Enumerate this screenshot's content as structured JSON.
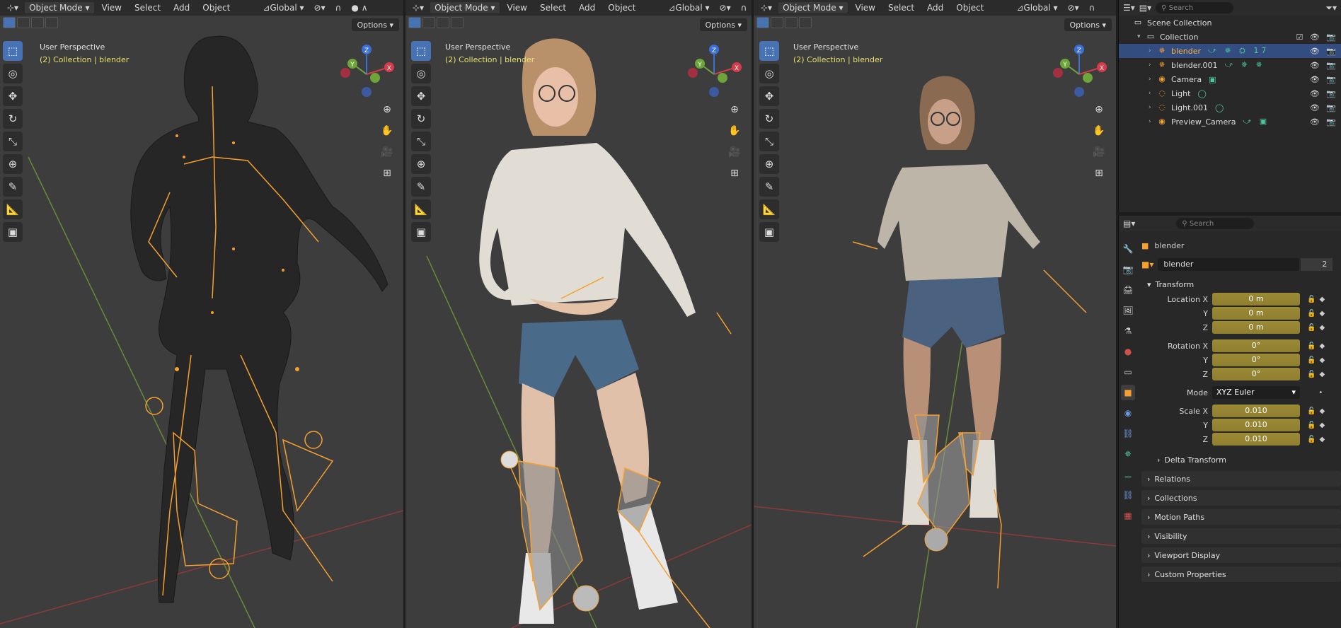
{
  "viewports": [
    {
      "header": {
        "mode": "Object Mode",
        "menus": [
          "View",
          "Select",
          "Add",
          "Object"
        ],
        "orientation": "Global"
      },
      "options": "Options",
      "perspective": "User Perspective",
      "collection_info": "(2) Collection | blender"
    },
    {
      "header": {
        "mode": "Object Mode",
        "menus": [
          "View",
          "Select",
          "Add",
          "Object"
        ],
        "orientation": "Global"
      },
      "options": "Options",
      "perspective": "User Perspective",
      "collection_info": "(2) Collection | blender"
    },
    {
      "header": {
        "mode": "Object Mode",
        "menus": [
          "View",
          "Select",
          "Add",
          "Object"
        ],
        "orientation": "Global"
      },
      "options": "Options",
      "perspective": "User Perspective",
      "collection_info": "(2) Collection | blender"
    }
  ],
  "gizmo": {
    "x": "X",
    "y": "Y",
    "z": "Z"
  },
  "outliner": {
    "search_placeholder": "Search",
    "scene_collection": "Scene Collection",
    "collection": "Collection",
    "items": [
      {
        "name": "blender",
        "extra": "17"
      },
      {
        "name": "blender.001",
        "extra": ""
      },
      {
        "name": "Camera",
        "extra": ""
      },
      {
        "name": "Light",
        "extra": ""
      },
      {
        "name": "Light.001",
        "extra": ""
      },
      {
        "name": "Preview_Camera",
        "extra": ""
      }
    ]
  },
  "properties": {
    "search_placeholder": "Search",
    "object_name": "blender",
    "data_name": "blender",
    "data_users": "2",
    "transform_label": "Transform",
    "location": {
      "label": "Location X",
      "x": "0 m",
      "y": "0 m",
      "z": "0 m"
    },
    "rotation": {
      "label": "Rotation X",
      "x": "0°",
      "y": "0°",
      "z": "0°"
    },
    "mode": {
      "label": "Mode",
      "value": "XYZ Euler"
    },
    "scale": {
      "label": "Scale X",
      "x": "0.010",
      "y": "0.010",
      "z": "0.010"
    },
    "axis_y": "Y",
    "axis_z": "Z",
    "delta_transform": "Delta Transform",
    "sections": [
      "Relations",
      "Collections",
      "Motion Paths",
      "Visibility",
      "Viewport Display",
      "Custom Properties"
    ]
  },
  "colors": {
    "accent": "#4772b3",
    "bone": "#f5a030",
    "field": "#9b8a36",
    "collection_text": "#e8e070"
  }
}
